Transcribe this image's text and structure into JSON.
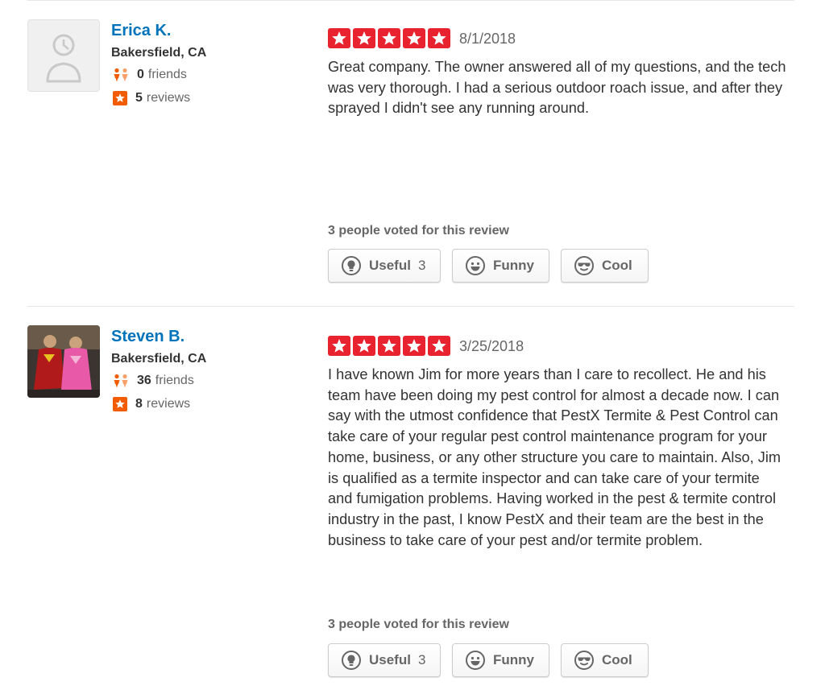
{
  "reviews": [
    {
      "name": "Erica K.",
      "location": "Bakersfield, CA",
      "friends_count": "0",
      "friends_label": "friends",
      "reviews_count": "5",
      "reviews_label": "reviews",
      "rating": 5,
      "date": "8/1/2018",
      "text": "Great company. The owner answered all of my questions, and the tech was very thorough. I had a serious outdoor roach issue, and after they sprayed I didn't see any running around.",
      "votes_text": "3 people voted for this review",
      "useful_label": "Useful",
      "useful_count": "3",
      "funny_label": "Funny",
      "cool_label": "Cool"
    },
    {
      "name": "Steven B.",
      "location": "Bakersfield, CA",
      "friends_count": "36",
      "friends_label": "friends",
      "reviews_count": "8",
      "reviews_label": "reviews",
      "rating": 5,
      "date": "3/25/2018",
      "text": "I have known Jim for more years than I care to recollect. He and his team have been doing my pest control for almost a decade now. I can say with the utmost confidence that PestX Termite & Pest Control can take care of your regular pest control maintenance program for your home, business, or any other structure you care to maintain. Also, Jim is qualified as a termite inspector and can take care of your termite and fumigation problems. Having worked in the pest & termite control industry in the past, I know PestX and their team are the best in the business to take care of your pest and/or termite problem.",
      "votes_text": "3 people voted for this review",
      "useful_label": "Useful",
      "useful_count": "3",
      "funny_label": "Funny",
      "cool_label": "Cool"
    }
  ],
  "colors": {
    "star_red": "#e8222e",
    "link_blue": "#0073bb",
    "friends_orange": "#f15c00",
    "review_badge_orange": "#f15c00"
  },
  "icons": [
    "person-placeholder-icon",
    "friends-icon",
    "review-star-badge-icon",
    "star-icon",
    "lightbulb-icon",
    "funny-face-icon",
    "sunglasses-face-icon"
  ]
}
